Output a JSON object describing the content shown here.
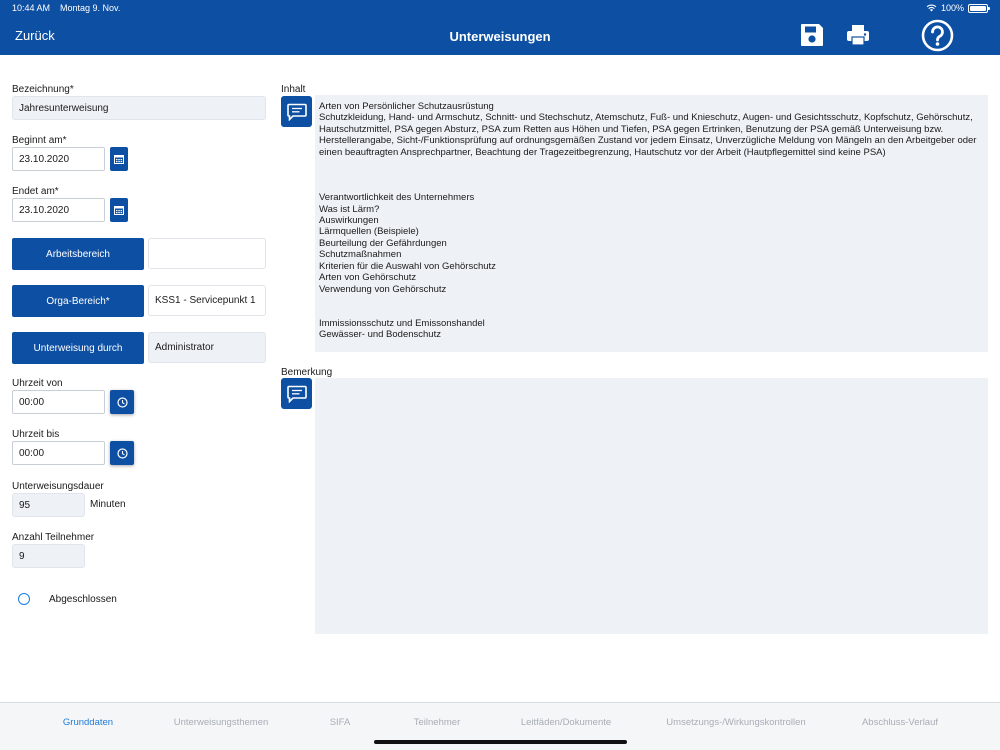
{
  "status": {
    "time": "10:44 AM",
    "date": "Montag 9. Nov.",
    "battery": "100%"
  },
  "header": {
    "back_label": "Zurück",
    "title": "Unterweisungen",
    "icons": [
      "save-icon",
      "printer-icon",
      "help-icon"
    ]
  },
  "colors": {
    "primary": "#0d4fa3",
    "field_bg": "#eef2f6",
    "active_tab": "#1f7bd8",
    "inactive_tab": "#a7adb5"
  },
  "form": {
    "bezeichnung": {
      "label": "Bezeichnung*",
      "value": "Jahresunterweisung"
    },
    "beginnt": {
      "label": "Beginnt am*",
      "value": "23.10.2020"
    },
    "endet": {
      "label": "Endet am*",
      "value": "23.10.2020"
    },
    "arbeitsbereich": {
      "button": "Arbeitsbereich",
      "value": ""
    },
    "orga": {
      "button": "Orga-Bereich*",
      "value": "KSS1 - Servicepunkt 1"
    },
    "durch": {
      "button": "Unterweisung durch",
      "value": "Administrator"
    },
    "uhrzeit_von": {
      "label": "Uhrzeit von",
      "value": "00:00"
    },
    "uhrzeit_bis": {
      "label": "Uhrzeit bis",
      "value": "00:00"
    },
    "dauer": {
      "label": "Unterweisungsdauer",
      "value": "95",
      "unit": "Minuten"
    },
    "teilnehmer": {
      "label": "Anzahl Teilnehmer",
      "value": "9"
    },
    "abgeschlossen": {
      "label": "Abgeschlossen",
      "checked": false
    }
  },
  "inhalt": {
    "label": "Inhalt",
    "text": "Arten von Persönlicher Schutzausrüstung\nSchutzkleidung, Hand- und Armschutz, Schnitt- und Stechschutz, Atemschutz, Fuß- und Knieschutz, Augen- und Gesichtsschutz, Kopfschutz, Gehörschutz, Hautschutzmittel, PSA gegen Absturz, PSA zum Retten aus Höhen und Tiefen, PSA gegen Ertrinken, Benutzung der PSA gemäß Unterweisung bzw. Herstellerangabe, Sicht-/Funktionsprüfung auf ordnungsgemäßen Zustand vor jedem Einsatz, Unverzügliche Meldung von Mängeln an den Arbeitgeber oder einen beauftragten Ansprechpartner, Beachtung der Tragezeitbegrenzung, Hautschutz vor der Arbeit (Hautpflegemittel sind keine PSA)\n\n\n\nVerantwortlichkeit des Unternehmers\nWas ist Lärm?\nAuswirkungen\nLärmquellen (Beispiele)\nBeurteilung der Gefährdungen\nSchutzmaßnahmen\nKriterien für die Auswahl von Gehörschutz\nArten von Gehörschutz\nVerwendung von Gehörschutz\n\n\nImmissionsschutz und Emissonshandel\nGewässer- und Bodenschutz"
  },
  "bemerkung": {
    "label": "Bemerkung",
    "text": ""
  },
  "tabs": [
    {
      "label": "Grunddaten",
      "active": true
    },
    {
      "label": "Unterweisungsthemen",
      "active": false
    },
    {
      "label": "SIFA",
      "active": false
    },
    {
      "label": "Teilnehmer",
      "active": false
    },
    {
      "label": "Leitfäden/Dokumente",
      "active": false
    },
    {
      "label": "Umsetzungs-/Wirkungskontrollen",
      "active": false
    },
    {
      "label": "Abschluss-Verlauf",
      "active": false
    }
  ]
}
